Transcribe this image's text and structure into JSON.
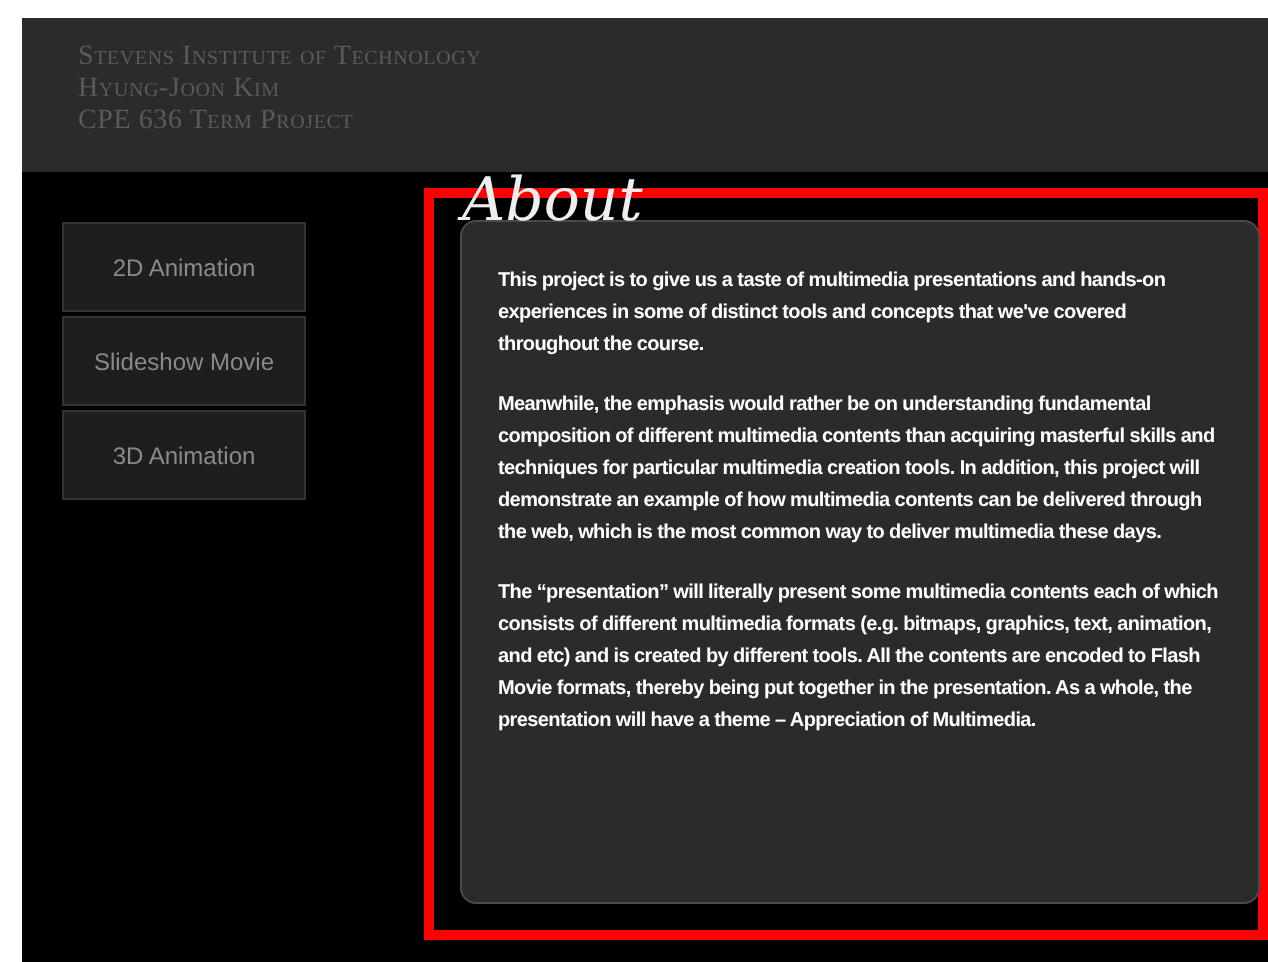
{
  "header": {
    "lines": [
      "Stevens Institute of Technology",
      "Hyung-Joon Kim",
      "CPE 636 Term Project"
    ]
  },
  "menu": [
    {
      "label": "2D Animation"
    },
    {
      "label": "Slideshow Movie"
    },
    {
      "label": "3D Animation"
    }
  ],
  "content": {
    "title": "About",
    "paragraphs": [
      "This project is to give us a taste of multimedia presentations and hands-on experiences in some of distinct tools and concepts that we've covered throughout the course.",
      "Meanwhile, the emphasis would rather be on understanding fundamental composition of different multimedia contents than acquiring masterful skills and techniques for particular multimedia creation tools. In addition, this  project will demonstrate an example of how multimedia contents can be delivered through the web, which is the most common way to deliver multimedia these days.",
      "The “presentation” will literally present some multimedia contents each of  which consists of different multimedia formats (e.g. bitmaps, graphics, text, animation, and etc) and is created by different tools. All the contents are encoded to Flash Movie formats, thereby being put together in the presentation. As a whole, the presentation will have a theme – Appreciation of Multimedia."
    ]
  }
}
